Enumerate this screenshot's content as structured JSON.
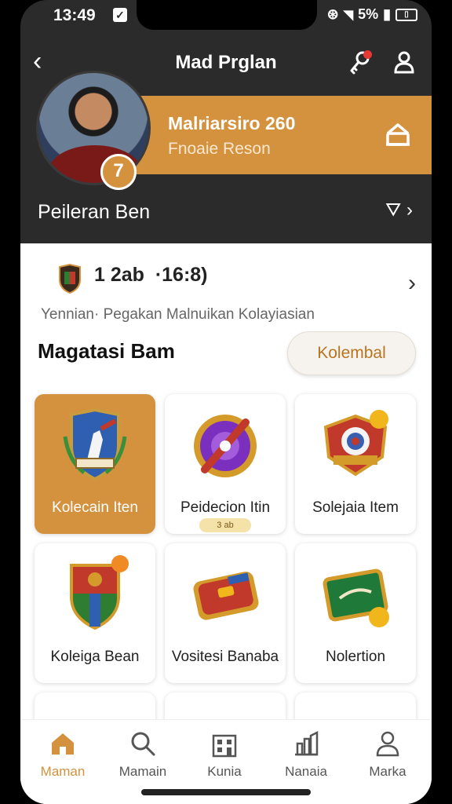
{
  "status_bar": {
    "time": "13:49",
    "battery": "5%"
  },
  "app_bar": {
    "title": "Mad Prglan",
    "back_icon": "chevron-left-icon",
    "key_icon": "key-icon",
    "user_icon": "user-icon"
  },
  "profile": {
    "name": "Malriarsiro 260",
    "subtitle": "Fnoaie Reson",
    "badge": "7",
    "accent": "#d4913e"
  },
  "subrow": {
    "label": "Peileran Ben"
  },
  "stats": {
    "value": "1 2ab  ·16:8)",
    "subtitle": "Yennian· Pegakan  Malnuikan Kolayiasian"
  },
  "section": {
    "title": "Magatasi Bam",
    "button": "Kolembal"
  },
  "items": [
    {
      "label": "Kolecain Iten",
      "icon": "crest-shield-icon",
      "selected": true
    },
    {
      "label": "Peidecion Itin",
      "icon": "purple-medal-icon",
      "tag": "3 ab"
    },
    {
      "label": "Solejaia Item",
      "icon": "target-badge-icon"
    },
    {
      "label": "Koleiga Bean",
      "icon": "red-shield-icon"
    },
    {
      "label": "Vositesi Banaba",
      "icon": "red-wallet-icon"
    },
    {
      "label": "Nolertion",
      "icon": "green-box-icon"
    }
  ],
  "nav": [
    {
      "label": "Maman",
      "icon": "home-icon",
      "active": true
    },
    {
      "label": "Mamain",
      "icon": "search-icon"
    },
    {
      "label": "Kunia",
      "icon": "building-icon"
    },
    {
      "label": "Nanaia",
      "icon": "chart-icon"
    },
    {
      "label": "Marka",
      "icon": "person-icon"
    }
  ]
}
